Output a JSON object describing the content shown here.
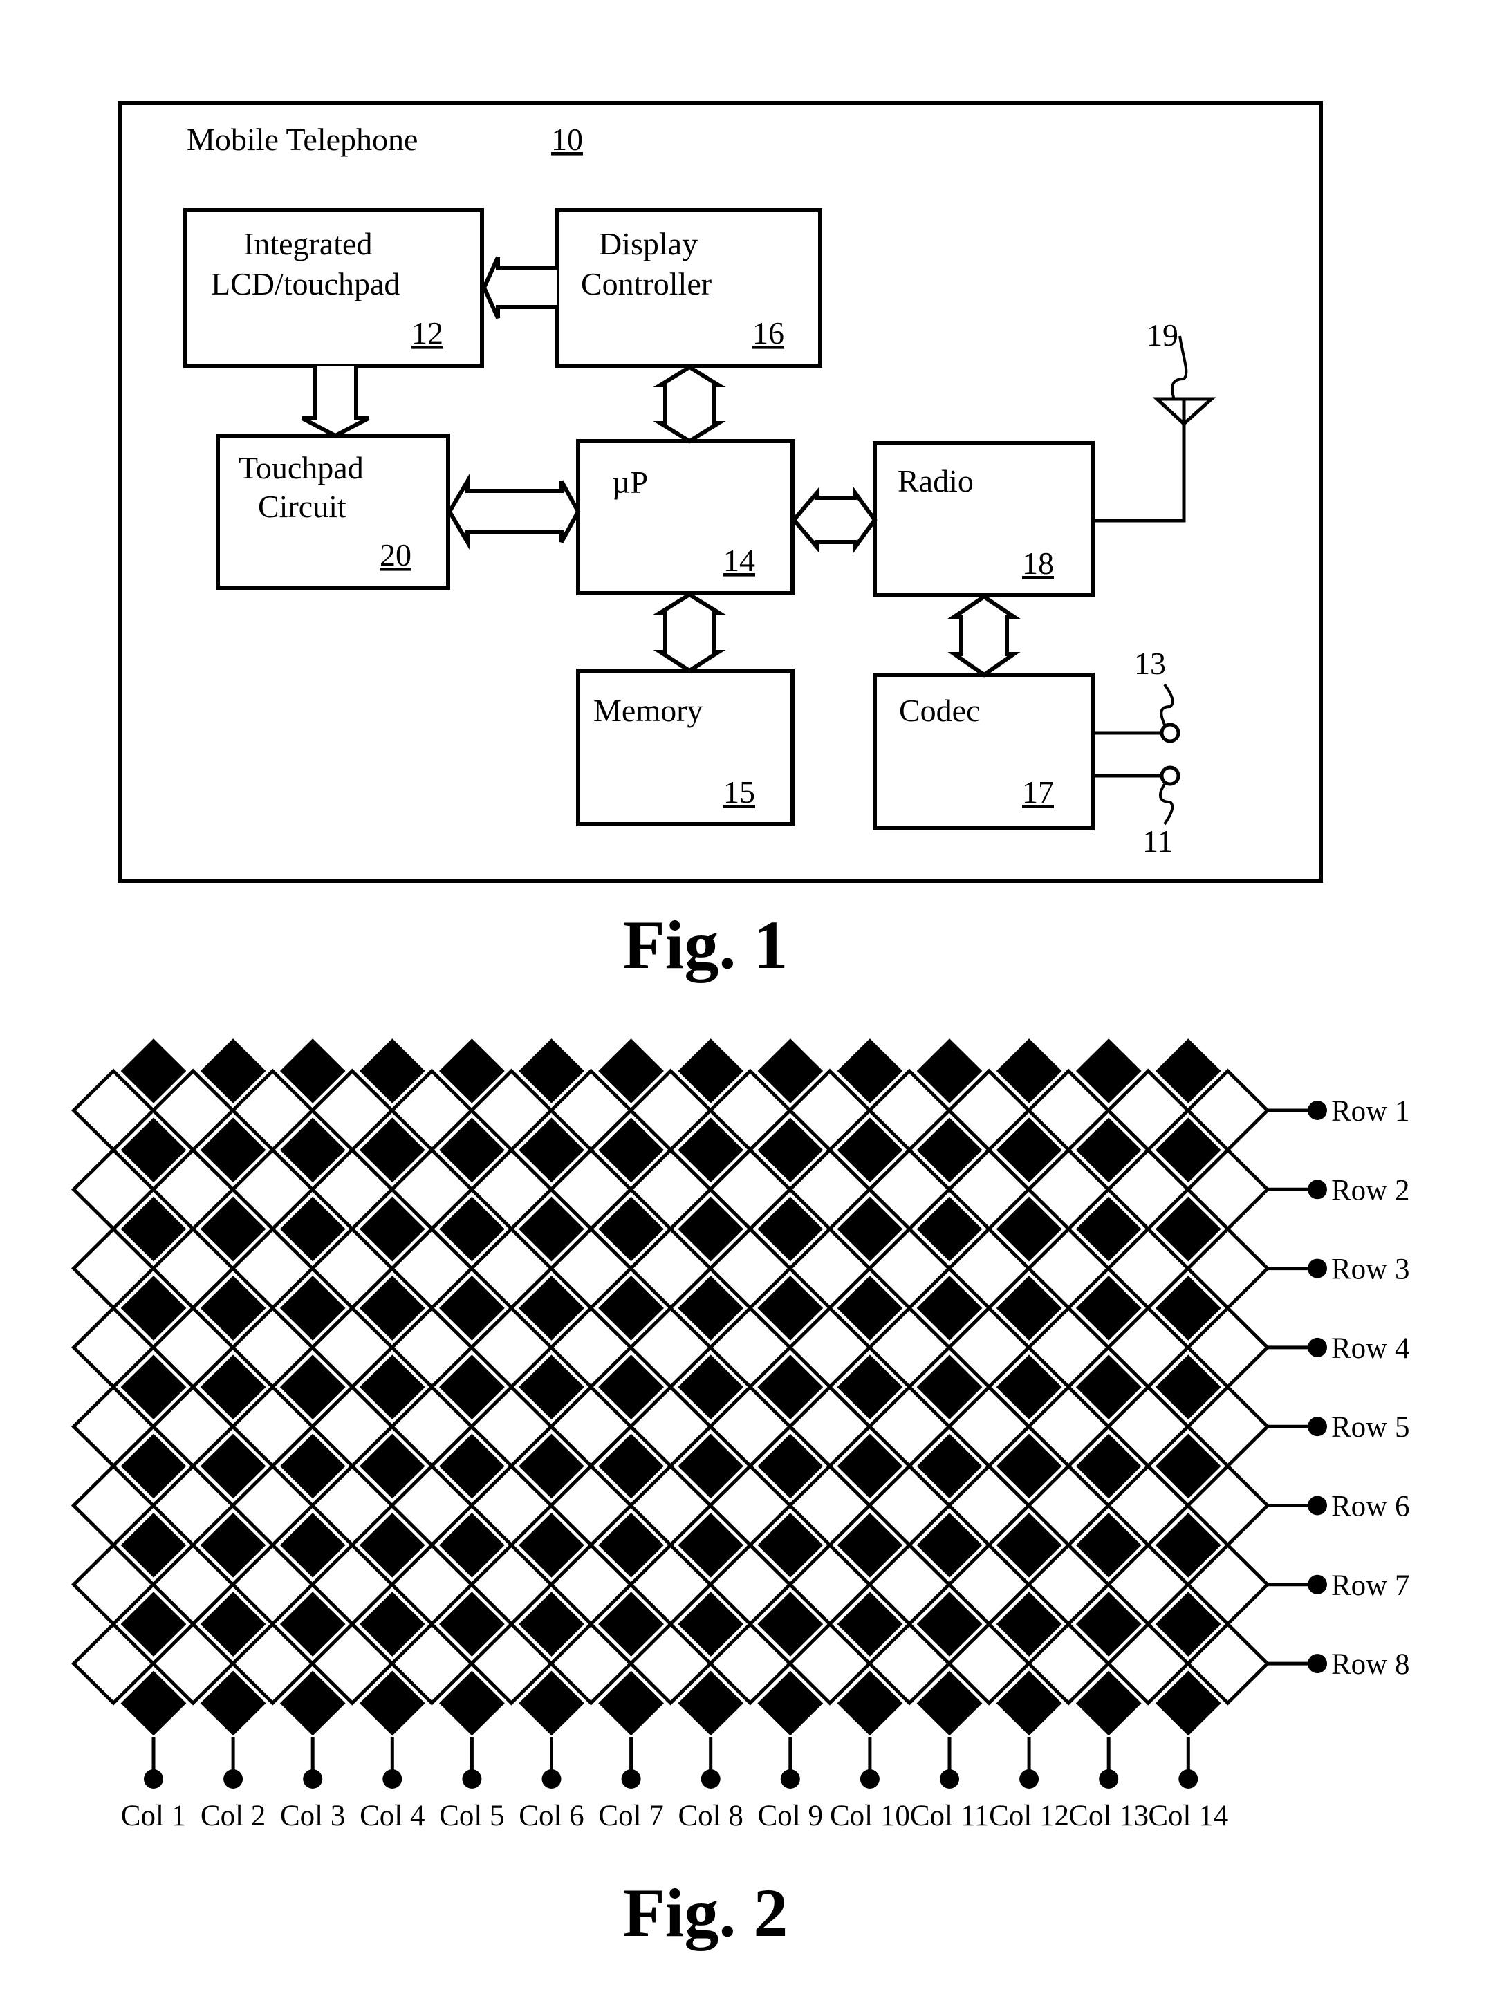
{
  "fig1": {
    "caption": "Fig. 1",
    "outer": {
      "label": "Mobile Telephone",
      "ref": "10"
    },
    "blocks": {
      "lcd": {
        "lines": [
          "Integrated",
          "LCD/touchpad"
        ],
        "ref": "12"
      },
      "display": {
        "lines": [
          "Display",
          "Controller"
        ],
        "ref": "16"
      },
      "touchpad": {
        "lines": [
          "Touchpad",
          "Circuit"
        ],
        "ref": "20"
      },
      "up": {
        "lines": [
          "µP"
        ],
        "ref": "14"
      },
      "radio": {
        "lines": [
          "Radio"
        ],
        "ref": "18"
      },
      "memory": {
        "lines": [
          "Memory"
        ],
        "ref": "15"
      },
      "codec": {
        "lines": [
          "Codec"
        ],
        "ref": "17"
      }
    },
    "antenna": {
      "ref": "19"
    },
    "speaker_terminal": {
      "ref": "13"
    },
    "mic_terminal": {
      "ref": "11"
    },
    "arrows": [
      {
        "from": "display",
        "to": "lcd",
        "type": "unidirectional"
      },
      {
        "from": "lcd",
        "to": "touchpad",
        "type": "unidirectional"
      },
      {
        "from": "display",
        "to": "up",
        "type": "bidirectional"
      },
      {
        "from": "touchpad",
        "to": "up",
        "type": "bidirectional"
      },
      {
        "from": "up",
        "to": "radio",
        "type": "bidirectional"
      },
      {
        "from": "up",
        "to": "memory",
        "type": "bidirectional"
      },
      {
        "from": "radio",
        "to": "codec",
        "type": "bidirectional"
      }
    ]
  },
  "fig2": {
    "caption": "Fig. 2",
    "rows": [
      "Row 1",
      "Row 2",
      "Row 3",
      "Row 4",
      "Row 5",
      "Row 6",
      "Row 7",
      "Row 8"
    ],
    "cols": [
      "Col 1",
      "Col 2",
      "Col 3",
      "Col 4",
      "Col 5",
      "Col 6",
      "Col 7",
      "Col 8",
      "Col 9",
      "Col 10",
      "Col 11",
      "Col 12",
      "Col 13",
      "Col 14"
    ],
    "row_electrode_color": "#ffffff",
    "col_electrode_color": "#000000"
  }
}
